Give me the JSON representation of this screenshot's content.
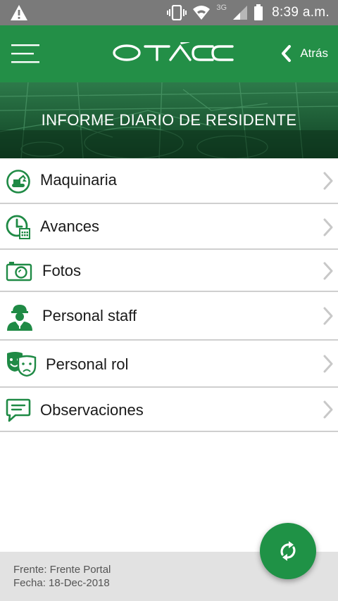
{
  "status_bar": {
    "time": "8:39 a.m.",
    "network": "3G",
    "icons": [
      "warning-icon",
      "vibrate-icon",
      "wifi-icon",
      "signal-icon",
      "battery-icon"
    ]
  },
  "header": {
    "logo_text": "OTACC",
    "back_label": "Atrás",
    "color": "#238f47"
  },
  "banner": {
    "title": "INFORME DIARIO DE RESIDENTE"
  },
  "menu": {
    "items": [
      {
        "label": "Maquinaria",
        "icon": "excavator-icon"
      },
      {
        "label": "Avances",
        "icon": "clock-calendar-icon"
      },
      {
        "label": "Fotos",
        "icon": "camera-icon"
      },
      {
        "label": "Personal staff",
        "icon": "worker-icon"
      },
      {
        "label": "Personal rol",
        "icon": "theater-masks-icon"
      },
      {
        "label": "Observaciones",
        "icon": "chat-icon"
      }
    ]
  },
  "footer": {
    "frente": "Frente: Frente Portal",
    "fecha": "Fecha: 18-Dec-2018"
  },
  "fab": {
    "icon": "sync-icon",
    "color": "#1f9246"
  }
}
